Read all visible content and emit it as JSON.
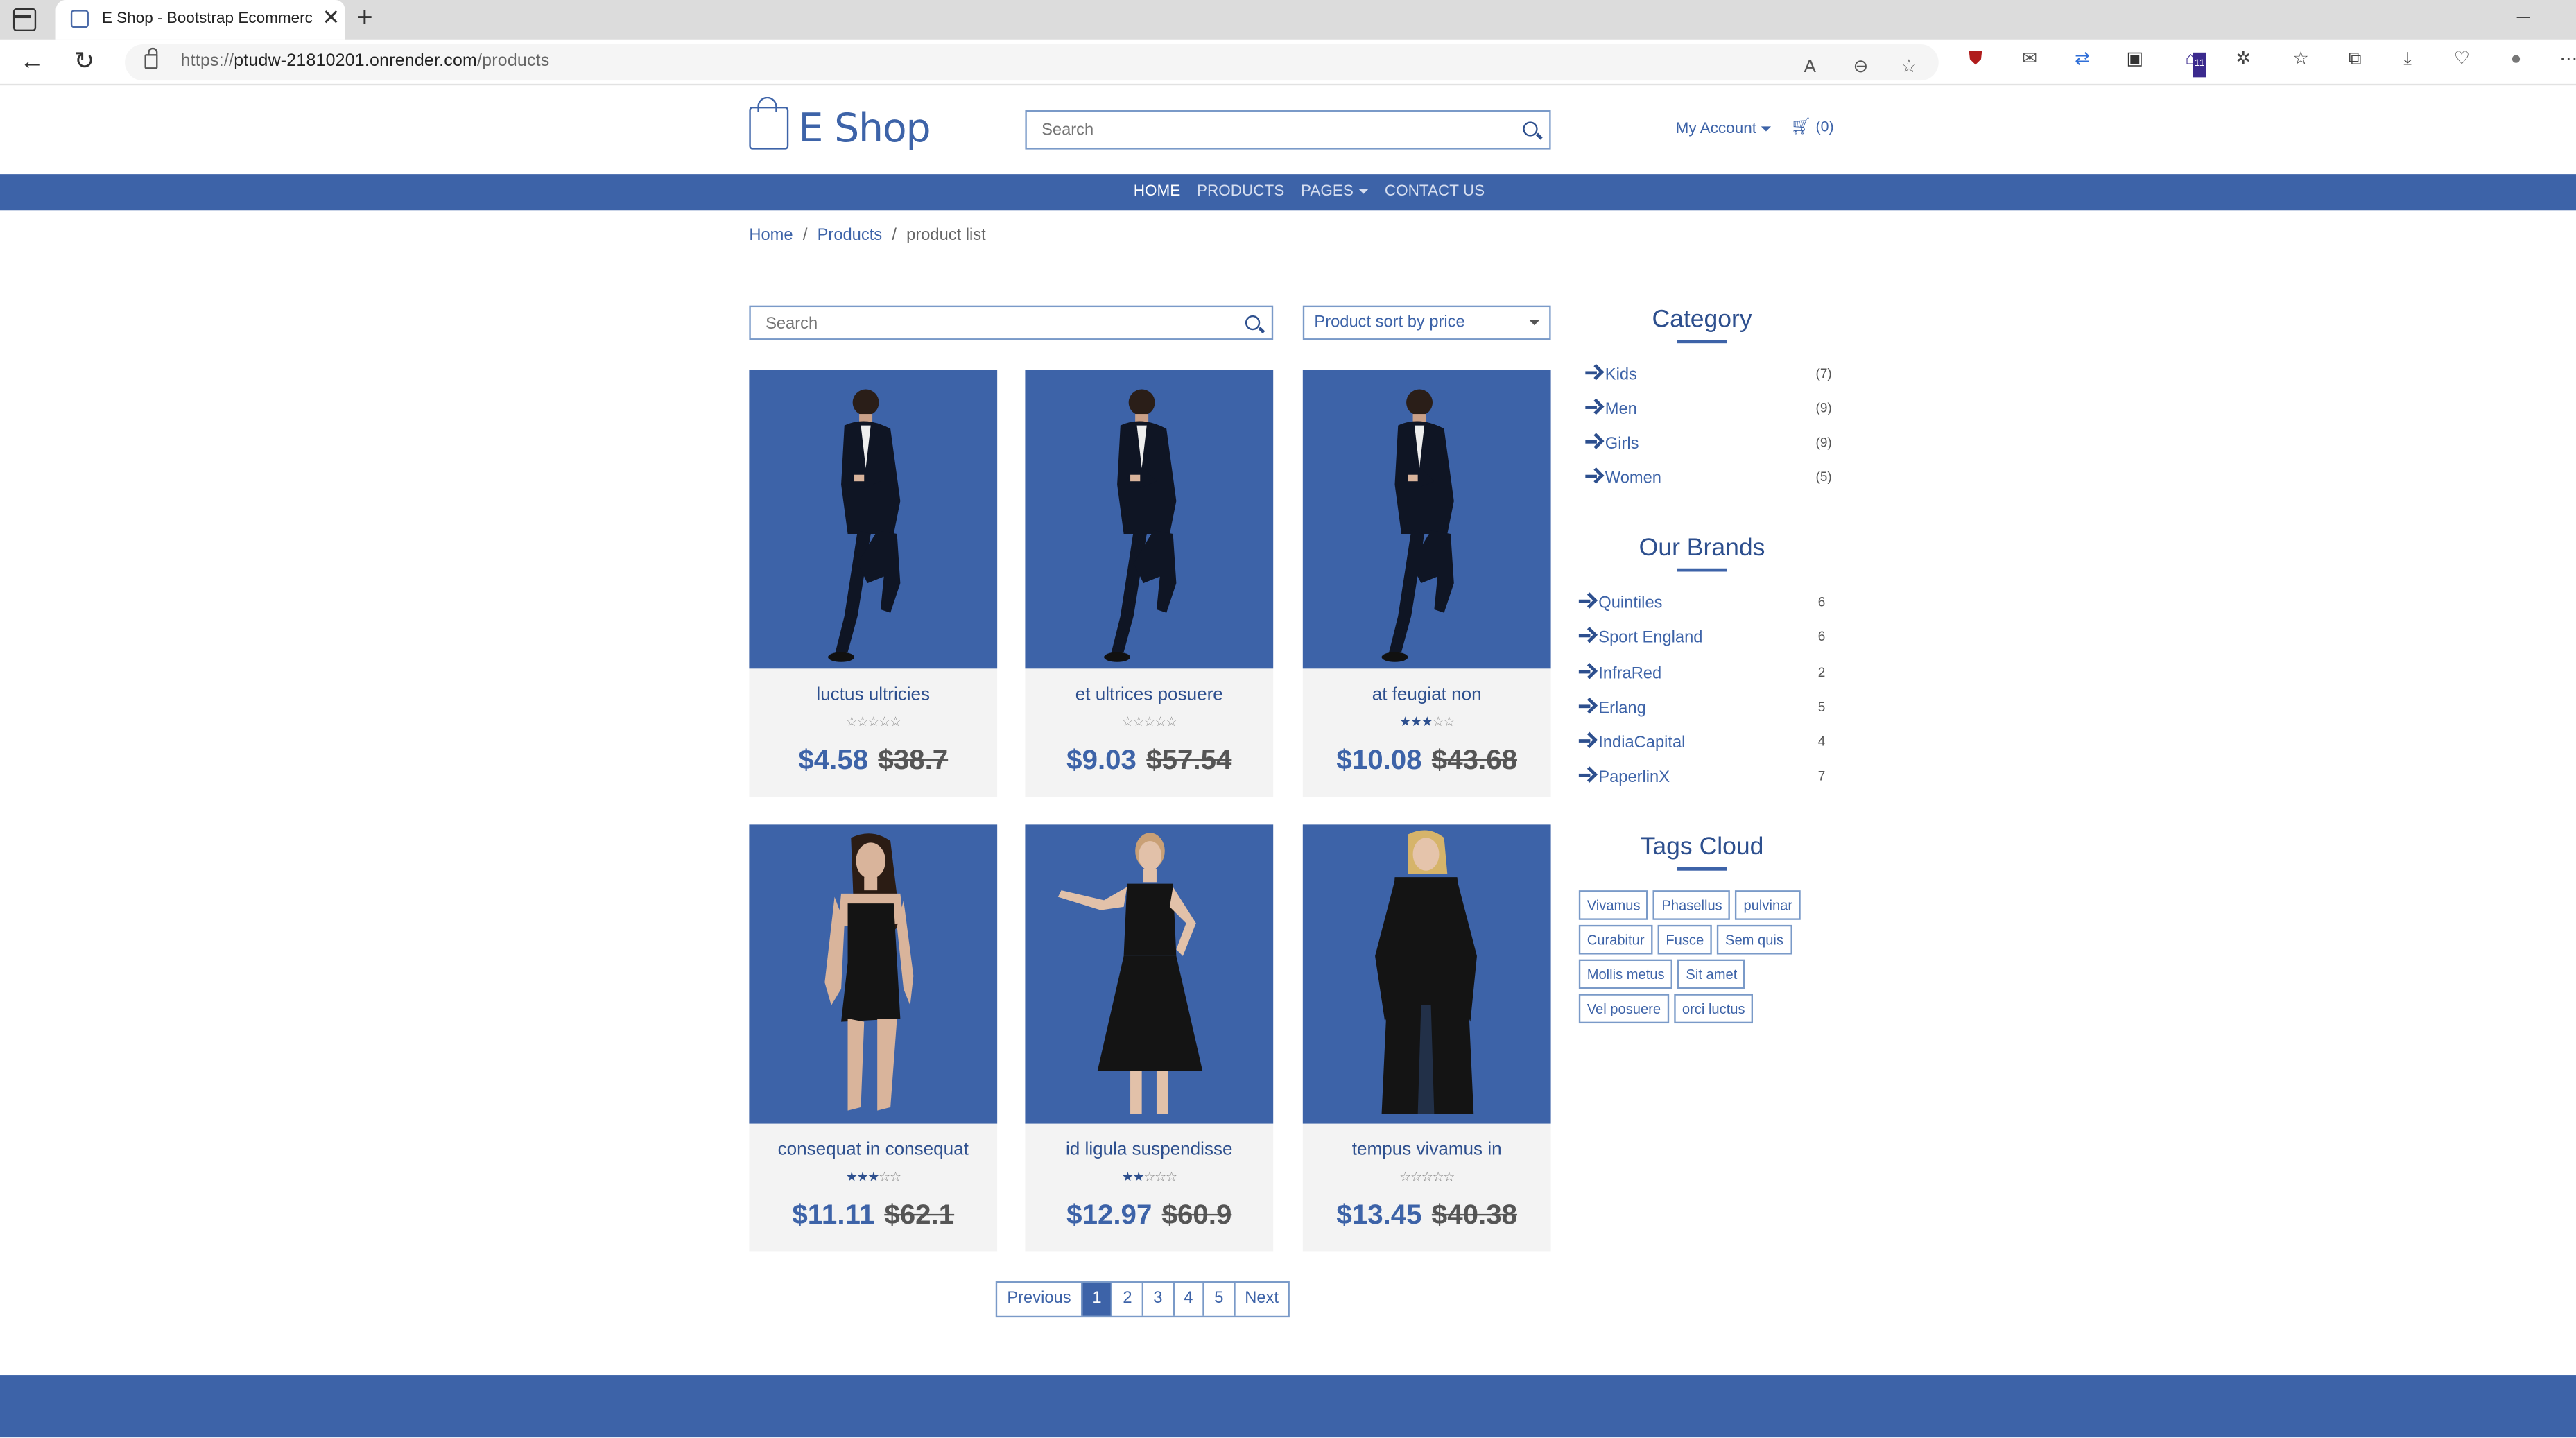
{
  "browser": {
    "tab_title": "E Shop - Bootstrap Ecommerce T",
    "url_prefix": "https://",
    "url_host": "ptudw-21810201.onrender.com",
    "url_path": "/products",
    "extension_badge": "11"
  },
  "header": {
    "logo_text": "E Shop",
    "search_placeholder": "Search",
    "account_label": "My Account",
    "cart_count": "(0)"
  },
  "nav": {
    "items": [
      "HOME",
      "PRODUCTS",
      "PAGES",
      "CONTACT US"
    ],
    "active": "HOME"
  },
  "breadcrumb": {
    "home": "Home",
    "products": "Products",
    "current": "product list"
  },
  "toolbar": {
    "search_placeholder": "Search",
    "sort_label": "Product sort by price"
  },
  "products": [
    {
      "name": "luctus ultricies",
      "price": "$4.58",
      "old_price": "$38.7",
      "rating": 0,
      "image": "man-in-suit-with-phone"
    },
    {
      "name": "et ultrices posuere",
      "price": "$9.03",
      "old_price": "$57.54",
      "rating": 0,
      "image": "man-in-suit-with-phone"
    },
    {
      "name": "at feugiat non",
      "price": "$10.08",
      "old_price": "$43.68",
      "rating": 2.5,
      "image": "man-in-suit-with-phone"
    },
    {
      "name": "consequat in consequat",
      "price": "$11.11",
      "old_price": "$62.1",
      "rating": 3,
      "image": "woman-in-black-mini-dress"
    },
    {
      "name": "id ligula suspendisse",
      "price": "$12.97",
      "old_price": "$60.9",
      "rating": 2,
      "image": "woman-in-black-dress"
    },
    {
      "name": "tempus vivamus in",
      "price": "$13.45",
      "old_price": "$40.38",
      "rating": 0,
      "image": "woman-in-black-coat"
    }
  ],
  "pagination": {
    "previous": "Previous",
    "pages": [
      "1",
      "2",
      "3",
      "4",
      "5"
    ],
    "active": "1",
    "next": "Next"
  },
  "sidebar": {
    "category_title": "Category",
    "categories": [
      {
        "name": "Kids",
        "count": "(7)"
      },
      {
        "name": "Men",
        "count": "(9)"
      },
      {
        "name": "Girls",
        "count": "(9)"
      },
      {
        "name": "Women",
        "count": "(5)"
      }
    ],
    "brands_title": "Our Brands",
    "brands": [
      {
        "name": "Quintiles",
        "count": "6"
      },
      {
        "name": "Sport England",
        "count": "6"
      },
      {
        "name": "InfraRed",
        "count": "2"
      },
      {
        "name": "Erlang",
        "count": "5"
      },
      {
        "name": "IndiaCapital",
        "count": "4"
      },
      {
        "name": "PaperlinX",
        "count": "7"
      }
    ],
    "tags_title": "Tags Cloud",
    "tags": [
      "Vivamus",
      "Phasellus",
      "pulvinar",
      "Curabitur",
      "Fusce",
      "Sem quis",
      "Mollis metus",
      "Sit amet",
      "Vel posuere",
      "orci luctus"
    ]
  },
  "colors": {
    "brand": "#3d63a8",
    "card_bg": "#f3f3f3",
    "text_dark": "#2d4f8e"
  }
}
